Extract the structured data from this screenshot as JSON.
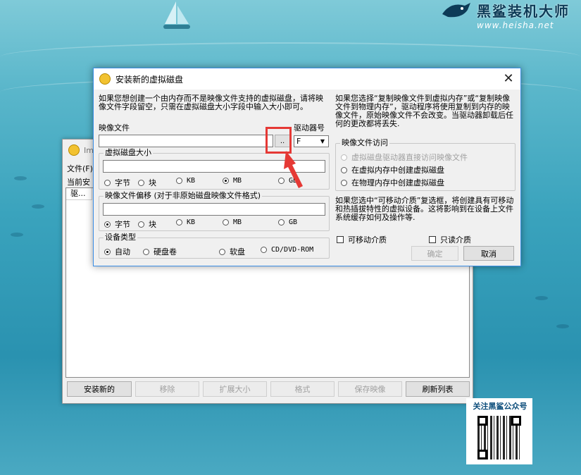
{
  "brand": {
    "name": "黑鲨装机大师",
    "url": "www.heisha.net"
  },
  "main_window": {
    "title": "Im",
    "menu": "文件(F)",
    "label": "当前安",
    "list_header": "驱...",
    "buttons": [
      "安装新的",
      "移除",
      "扩展大小",
      "格式",
      "保存映像",
      "刷新列表"
    ]
  },
  "dialog": {
    "title": "安装新的虚拟磁盘",
    "close": "✕",
    "left_info": "如果您想创建一个由内存而不是映像文件支持的虚拟磁盘，请将映像文件字段留空，只需在虚拟磁盘大小字段中输入大小即可。",
    "image_file_label": "映像文件",
    "image_file_value": "",
    "browse_label": "..",
    "drive_letter_label": "驱动器号",
    "drive_letter_value": "F",
    "disk_size_group": "虚拟磁盘大小",
    "disk_size_value": "",
    "size_units": [
      "字节",
      "块",
      "KB",
      "MB",
      "GB"
    ],
    "size_unit_selected": "MB",
    "offset_group": "映像文件偏移 (对于非原始磁盘映像文件格式)",
    "offset_value": "",
    "offset_units": [
      "字节",
      "块",
      "KB",
      "MB",
      "GB"
    ],
    "offset_unit_selected": "字节",
    "device_type_group": "设备类型",
    "device_types": [
      "自动",
      "硬盘卷",
      "软盘",
      "CD/DVD-ROM"
    ],
    "device_type_selected": "自动",
    "right_info": "如果您选择“复制映像文件到虚拟内存”或“复制映像文件到物理内存”，驱动程序将使用复制到内存的映像文件，原始映像文件不会改变。当驱动器卸载后任何的更改都将丢失.",
    "access_group": "映像文件访问",
    "access_options": [
      "虚拟磁盘驱动器直接访问映像文件",
      "在虚拟内存中创建虚拟磁盘",
      "在物理内存中创建虚拟磁盘"
    ],
    "removable_info": "如果您选中“可移动介质”复选框，将创建具有可移动和热插拔特性的虚拟设备。这将影响到在设备上文件系统缓存如何及操作等.",
    "removable_label": "可移动介质",
    "readonly_label": "只读介质",
    "ok_label": "确定",
    "cancel_label": "取消"
  },
  "promo": {
    "title": "关注黑鲨公众号"
  },
  "colors": {
    "accent": "#0078d7",
    "highlight": "#e53935",
    "titlebar_border": "#3a8ee6"
  }
}
